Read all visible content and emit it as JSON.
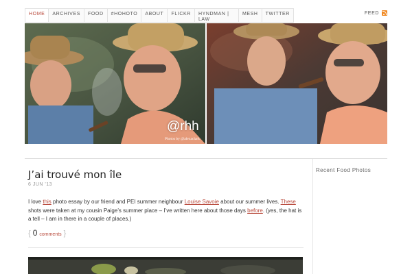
{
  "nav": {
    "items": [
      {
        "label": "HOME"
      },
      {
        "label": "ARCHIVES"
      },
      {
        "label": "FOOD"
      },
      {
        "label": "#HOHOTO"
      },
      {
        "label": "ABOUT"
      },
      {
        "label": "FLICKR"
      },
      {
        "label": "HYNDMAN | LAW"
      },
      {
        "label": "MESH"
      },
      {
        "label": "TWITTER"
      }
    ],
    "active": "HOME",
    "feed_label": "FEED",
    "feed_icon": "rss-icon"
  },
  "banner": {
    "watermark": "@rhh",
    "credit": "Photos by @alexaclark"
  },
  "post": {
    "title": "J’ai trouvé mon île",
    "date": "6 JUN '13",
    "body": {
      "p1": "I love ",
      "link1": "this",
      "p2": " photo essay by our friend and PEI summer neighbour ",
      "link2": "Louise Savoie",
      "p3": " about our summer lives.  ",
      "link3": "These",
      "p4": " shots were taken at my cousin Paige’s summer place – I’ve written here about those days ",
      "link4": "before",
      "p5": ". (yes, the hat is a tell – I am in there in a couple of places.)"
    },
    "comments": {
      "open_brace": "{",
      "count": "0",
      "label": "comments",
      "close_brace": "}"
    }
  },
  "sidebar": {
    "heading": "Recent Food Photos"
  },
  "colors": {
    "accent": "#b8483a",
    "rss": "#f08a24"
  }
}
